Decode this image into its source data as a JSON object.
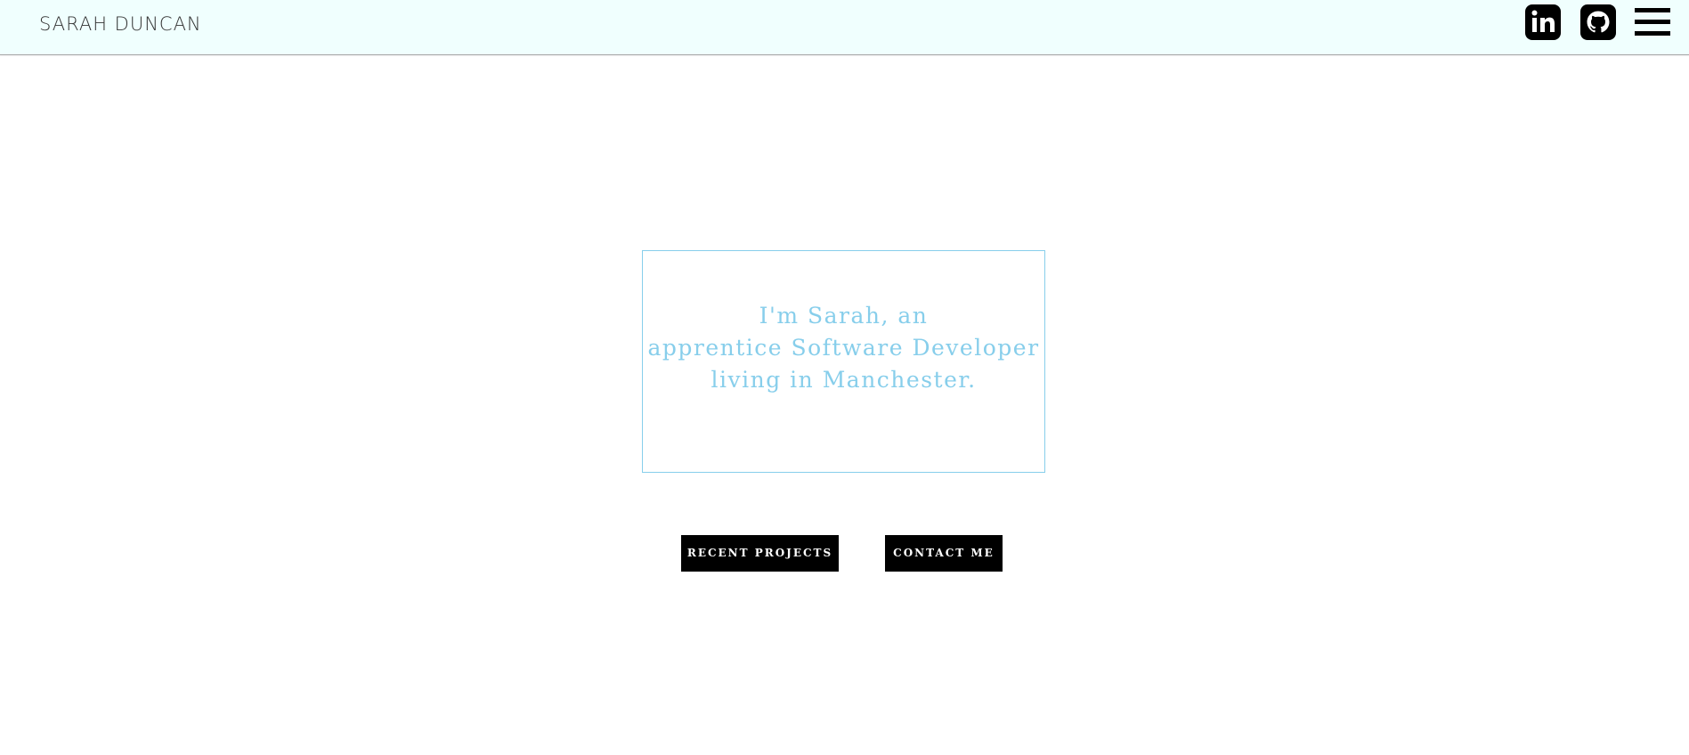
{
  "header": {
    "brand": "SARAH DUNCAN",
    "icons": {
      "linkedin": "linkedin-icon",
      "github": "github-icon",
      "menu": "hamburger-menu-icon"
    },
    "background": "#f0fffe"
  },
  "intro": {
    "line1": "I'm Sarah, an",
    "line2": "apprentice Software Developer",
    "line3": "living in Manchester.",
    "accent_color": "#87ceeb"
  },
  "actions": {
    "projects_label": "RECENT PROJECTS",
    "contact_label": "CONTACT ME"
  }
}
